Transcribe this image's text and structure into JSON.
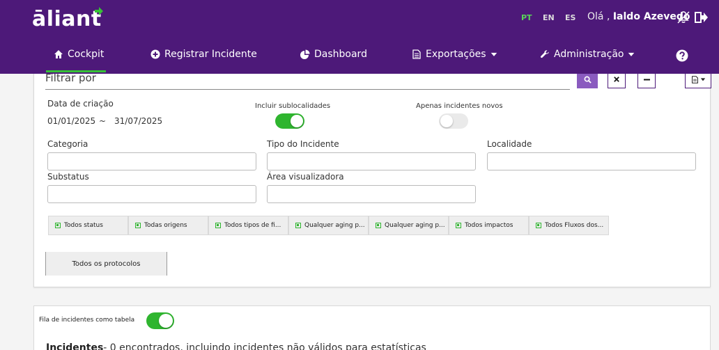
{
  "header": {
    "logo": "āliant",
    "languages": [
      {
        "code": "PT",
        "active": true
      },
      {
        "code": "EN",
        "active": false
      },
      {
        "code": "ES",
        "active": false
      }
    ],
    "greeting": "Olá ,",
    "user_name": "Ialdo Azevedo"
  },
  "nav": {
    "cockpit": "Cockpit",
    "registrar": "Registrar Incidente",
    "dashboard": "Dashboard",
    "exportacoes": "Exportações",
    "administracao": "Administração"
  },
  "filter": {
    "title": "Filtrar por",
    "data_criacao_label": "Data de criação",
    "date_from": "01/01/2025",
    "date_sep": "~",
    "date_to": "31/07/2025",
    "incluir_sub_label": "Incluir sublocalidades",
    "incluir_sub_on": true,
    "apenas_novos_label": "Apenas incidentes novos",
    "apenas_novos_on": false,
    "categoria_label": "Categoria",
    "tipo_label": "Tipo do Incidente",
    "localidade_label": "Localidade",
    "substatus_label": "Substatus",
    "area_label": "Área visualizadora",
    "chips": [
      "Todos status",
      "Todas origens",
      "Todos tipos de fi...",
      "Qualquer aging p...",
      "Qualquer aging p...",
      "Todos impactos",
      "Todos Fluxos dos..."
    ],
    "protocolos": "Todos os protocolos"
  },
  "queue": {
    "fila_label": "Fila de incidentes como tabela",
    "fila_on": true,
    "incidentes_title": "Incidentes",
    "incidentes_text": "- 0 encontrados, incluindo incidentes não válidos para estatísticas"
  },
  "colors": {
    "brand": "#4d1979",
    "accent_green": "#2fb52f",
    "search_button": "#8a5bbf"
  }
}
